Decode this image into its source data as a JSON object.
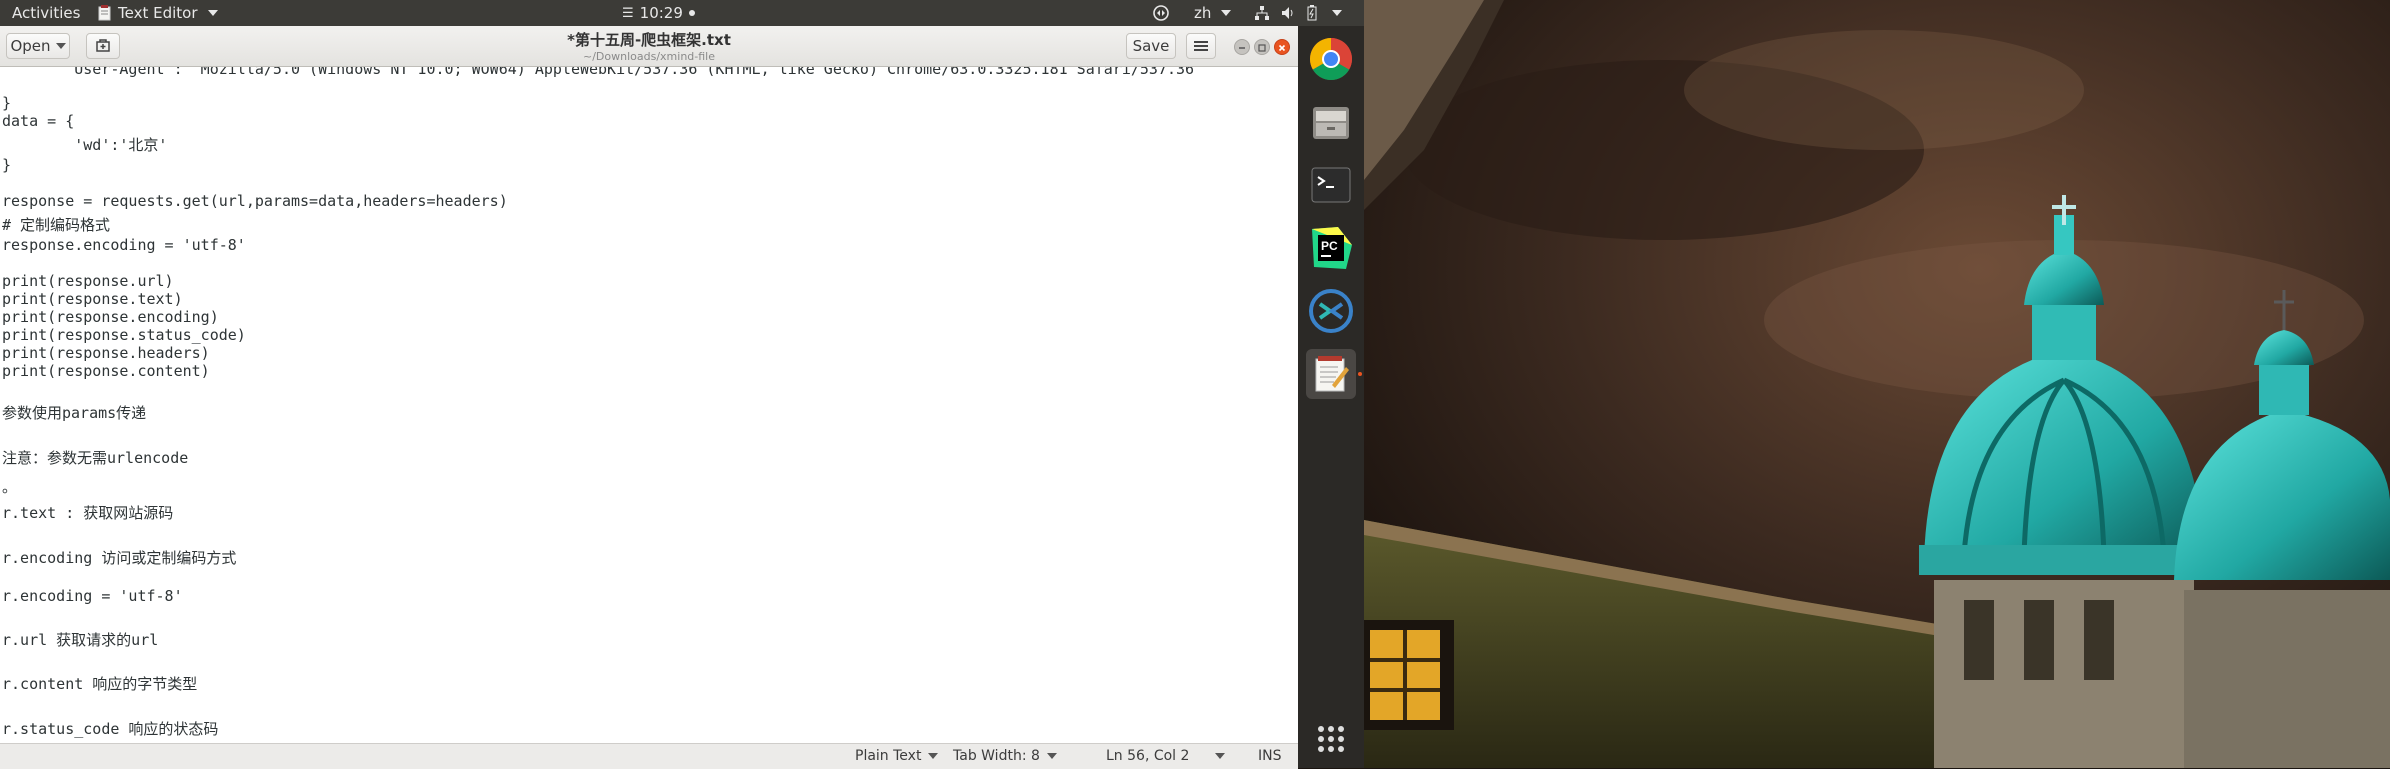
{
  "topbar": {
    "activities": "Activities",
    "app_menu": "Text Editor",
    "clock": "10:29",
    "input_method": "zh"
  },
  "window": {
    "title": "*第十五周-爬虫框架.txt",
    "subtitle": "~/Downloads/xmind-file",
    "open_label": "Open",
    "save_label": "Save"
  },
  "editor": {
    "lines": [
      "        User-Agent :  Mozilla/5.0 (Windows NT 10.0; WOW64) AppleWebKit/537.36 (KHTML, like Gecko) Chrome/63.0.3325.181 Safari/537.36",
      "}",
      "data = {",
      "        'wd':'北京'",
      "}",
      "response = requests.get(url,params=data,headers=headers)",
      "# 定制编码格式",
      "response.encoding = 'utf-8'",
      "print(response.url)",
      "print(response.text)",
      "print(response.encoding)",
      "print(response.status_code)",
      "print(response.headers)",
      "print(response.content)",
      "参数使用params传递",
      "注意：参数无需urlencode",
      "。",
      "r.text : 获取网站源码",
      "r.encoding 访问或定制编码方式",
      "r.encoding = 'utf-8'",
      "r.url 获取请求的url",
      "r.content 响应的字节类型",
      "r.status_code 响应的状态码"
    ]
  },
  "statusbar": {
    "language": "Plain Text",
    "tab_width": "Tab Width: 8",
    "position": "Ln 56, Col 2",
    "mode": "INS"
  },
  "dock": {
    "apps": [
      "chrome-icon",
      "files-icon",
      "terminal-icon",
      "pycharm-icon",
      "remote-desktop-icon",
      "text-editor-icon",
      "show-apps-icon"
    ]
  },
  "colors": {
    "topbar": "#3c3b37",
    "dock": "#2b2926",
    "dome_teal": "#2fb8b4"
  }
}
